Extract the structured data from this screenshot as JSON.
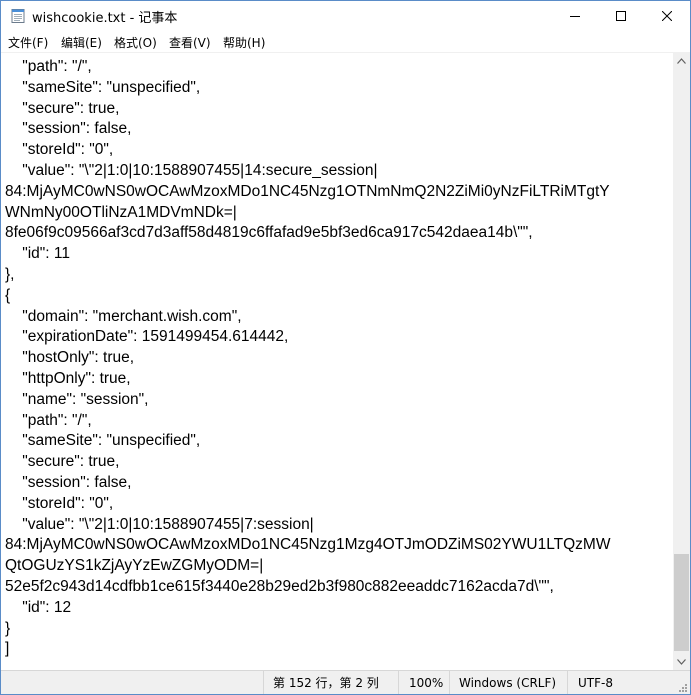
{
  "window": {
    "title": "wishcookie.txt - 记事本"
  },
  "menu": {
    "items": [
      "文件(F)",
      "编辑(E)",
      "格式(O)",
      "查看(V)",
      "帮助(H)"
    ]
  },
  "editor": {
    "lines": [
      "    \"path\": \"/\",",
      "    \"sameSite\": \"unspecified\",",
      "    \"secure\": true,",
      "    \"session\": false,",
      "    \"storeId\": \"0\",",
      "    \"value\": \"\\\"2|1:0|10:1588907455|14:secure_session|",
      "84:MjAyMC0wNS0wOCAwMzoxMDo1NC45Nzg1OTNmNmQ2N2ZiMi0yNzFiLTRiMTgtY",
      "WNmNy00OTliNzA1MDVmNDk=|",
      "8fe06f9c09566af3cd7d3aff58d4819c6ffafad9e5bf3ed6ca917c542daea14b\\\"\",",
      "    \"id\": 11",
      "},",
      "{",
      "    \"domain\": \"merchant.wish.com\",",
      "    \"expirationDate\": 1591499454.614442,",
      "    \"hostOnly\": true,",
      "    \"httpOnly\": true,",
      "    \"name\": \"session\",",
      "    \"path\": \"/\",",
      "    \"sameSite\": \"unspecified\",",
      "    \"secure\": true,",
      "    \"session\": false,",
      "    \"storeId\": \"0\",",
      "    \"value\": \"\\\"2|1:0|10:1588907455|7:session|",
      "84:MjAyMC0wNS0wOCAwMzoxMDo1NC45Nzg1Mzg4OTJmODZiMS02YWU1LTQzMW",
      "QtOGUzYS1kZjAyYzEwZGMyODM=|",
      "52e5f2c943d14cdfbb1ce615f3440e28b29ed2b3f980c882eeaddc7162acda7d\\\"\",",
      "    \"id\": 12",
      "}",
      "]"
    ]
  },
  "statusbar": {
    "position": "第 152 行，第 2 列",
    "zoom": "100%",
    "line_ending": "Windows (CRLF)",
    "encoding": "UTF-8"
  }
}
